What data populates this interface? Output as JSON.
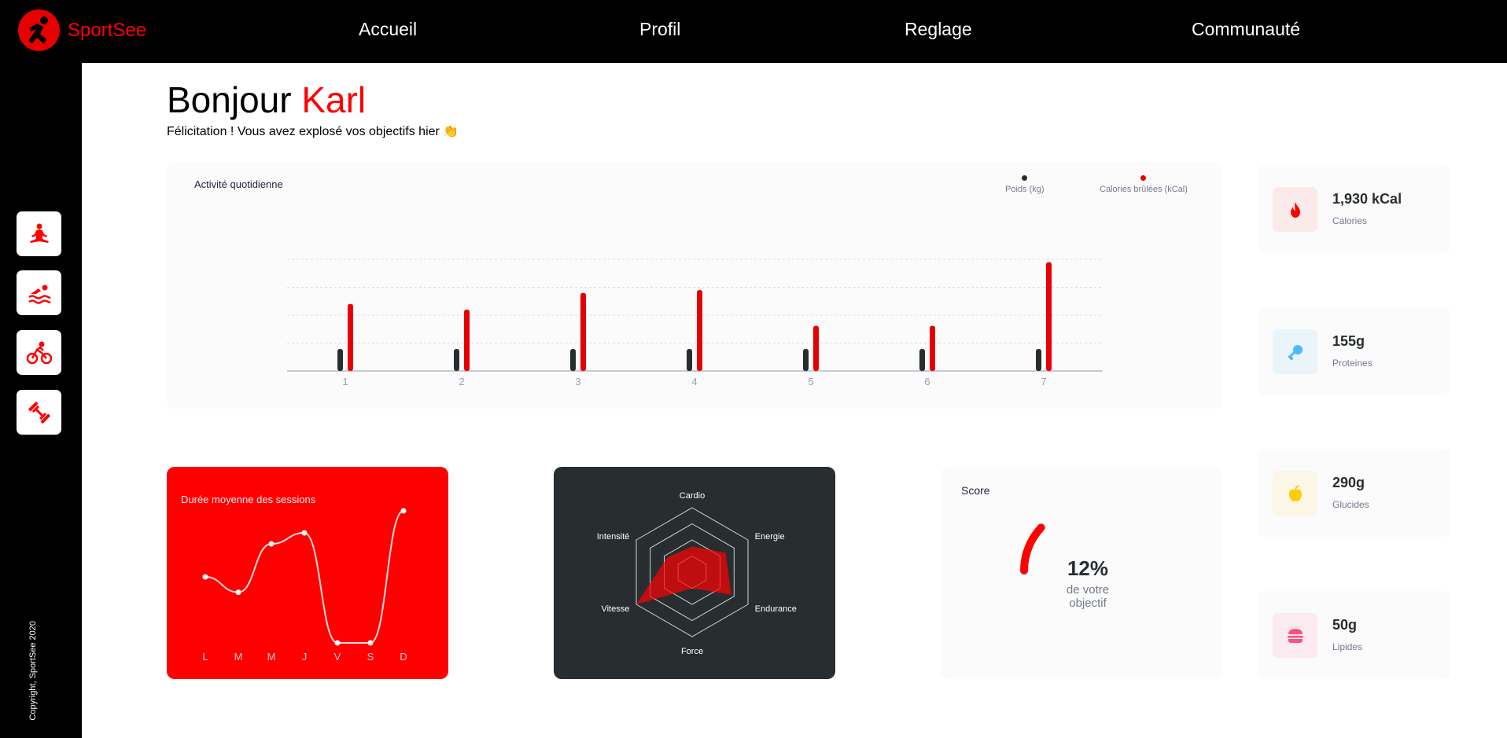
{
  "app": {
    "brand": "SportSee"
  },
  "nav": [
    {
      "label": "Accueil"
    },
    {
      "label": "Profil"
    },
    {
      "label": "Reglage"
    },
    {
      "label": "Communauté"
    }
  ],
  "sidebar": {
    "icons": [
      "yoga-icon",
      "swimming-icon",
      "cycling-icon",
      "dumbbell-icon"
    ],
    "copyright": "Copyright, SportSee 2020"
  },
  "header": {
    "greeting": "Bonjour",
    "name": "Karl",
    "subtitle": "Félicitation ! Vous avez explosé vos objectifs hier 👏"
  },
  "activity": {
    "title": "Activité quotidienne",
    "legend_weight": "Poids (kg)",
    "legend_calories": "Calories brûlées (kCal)"
  },
  "nutrition": [
    {
      "value": "1,930 kCal",
      "label": "Calories",
      "icon": "flame-icon",
      "bg": "#FBEAEA",
      "color": "#FF0000"
    },
    {
      "value": "155g",
      "label": "Proteines",
      "icon": "chicken-leg-icon",
      "bg": "#E9F4FB",
      "color": "#4AB8FF"
    },
    {
      "value": "290g",
      "label": "Glucides",
      "icon": "apple-icon",
      "bg": "#FBF6E5",
      "color": "#FDCC0C"
    },
    {
      "value": "50g",
      "label": "Lipides",
      "icon": "burger-icon",
      "bg": "#FBEAEF",
      "color": "#FD5181"
    }
  ],
  "sessions": {
    "title": "Durée moyenne des sessions"
  },
  "score": {
    "title": "Score",
    "value": "12%",
    "caption": "de votre objectif",
    "fraction": 0.12
  },
  "chart_data": [
    {
      "type": "bar",
      "title": "Activité quotidienne",
      "categories": [
        "1",
        "2",
        "3",
        "4",
        "5",
        "6",
        "7"
      ],
      "series": [
        {
          "name": "Poids (kg)",
          "values": [
            80,
            80,
            80,
            80,
            80,
            80,
            80
          ]
        },
        {
          "name": "Calories brûlées (kCal)",
          "values": [
            240,
            220,
            280,
            290,
            162,
            162,
            390
          ]
        }
      ],
      "grid": true,
      "legend": "top-right",
      "colors": {
        "weight": "#282D30",
        "calories": "#E60000"
      }
    },
    {
      "type": "line",
      "title": "Durée moyenne des sessions",
      "categories": [
        "L",
        "M",
        "M",
        "J",
        "V",
        "S",
        "D"
      ],
      "values": [
        30,
        23,
        45,
        50,
        0,
        0,
        60
      ],
      "grid": false
    },
    {
      "type": "radar",
      "categories": [
        "Cardio",
        "Energie",
        "Endurance",
        "Force",
        "Vitesse",
        "Intensité"
      ],
      "values": [
        80,
        120,
        140,
        50,
        200,
        90
      ],
      "range": [
        0,
        200
      ],
      "color": "#FF0101"
    }
  ]
}
